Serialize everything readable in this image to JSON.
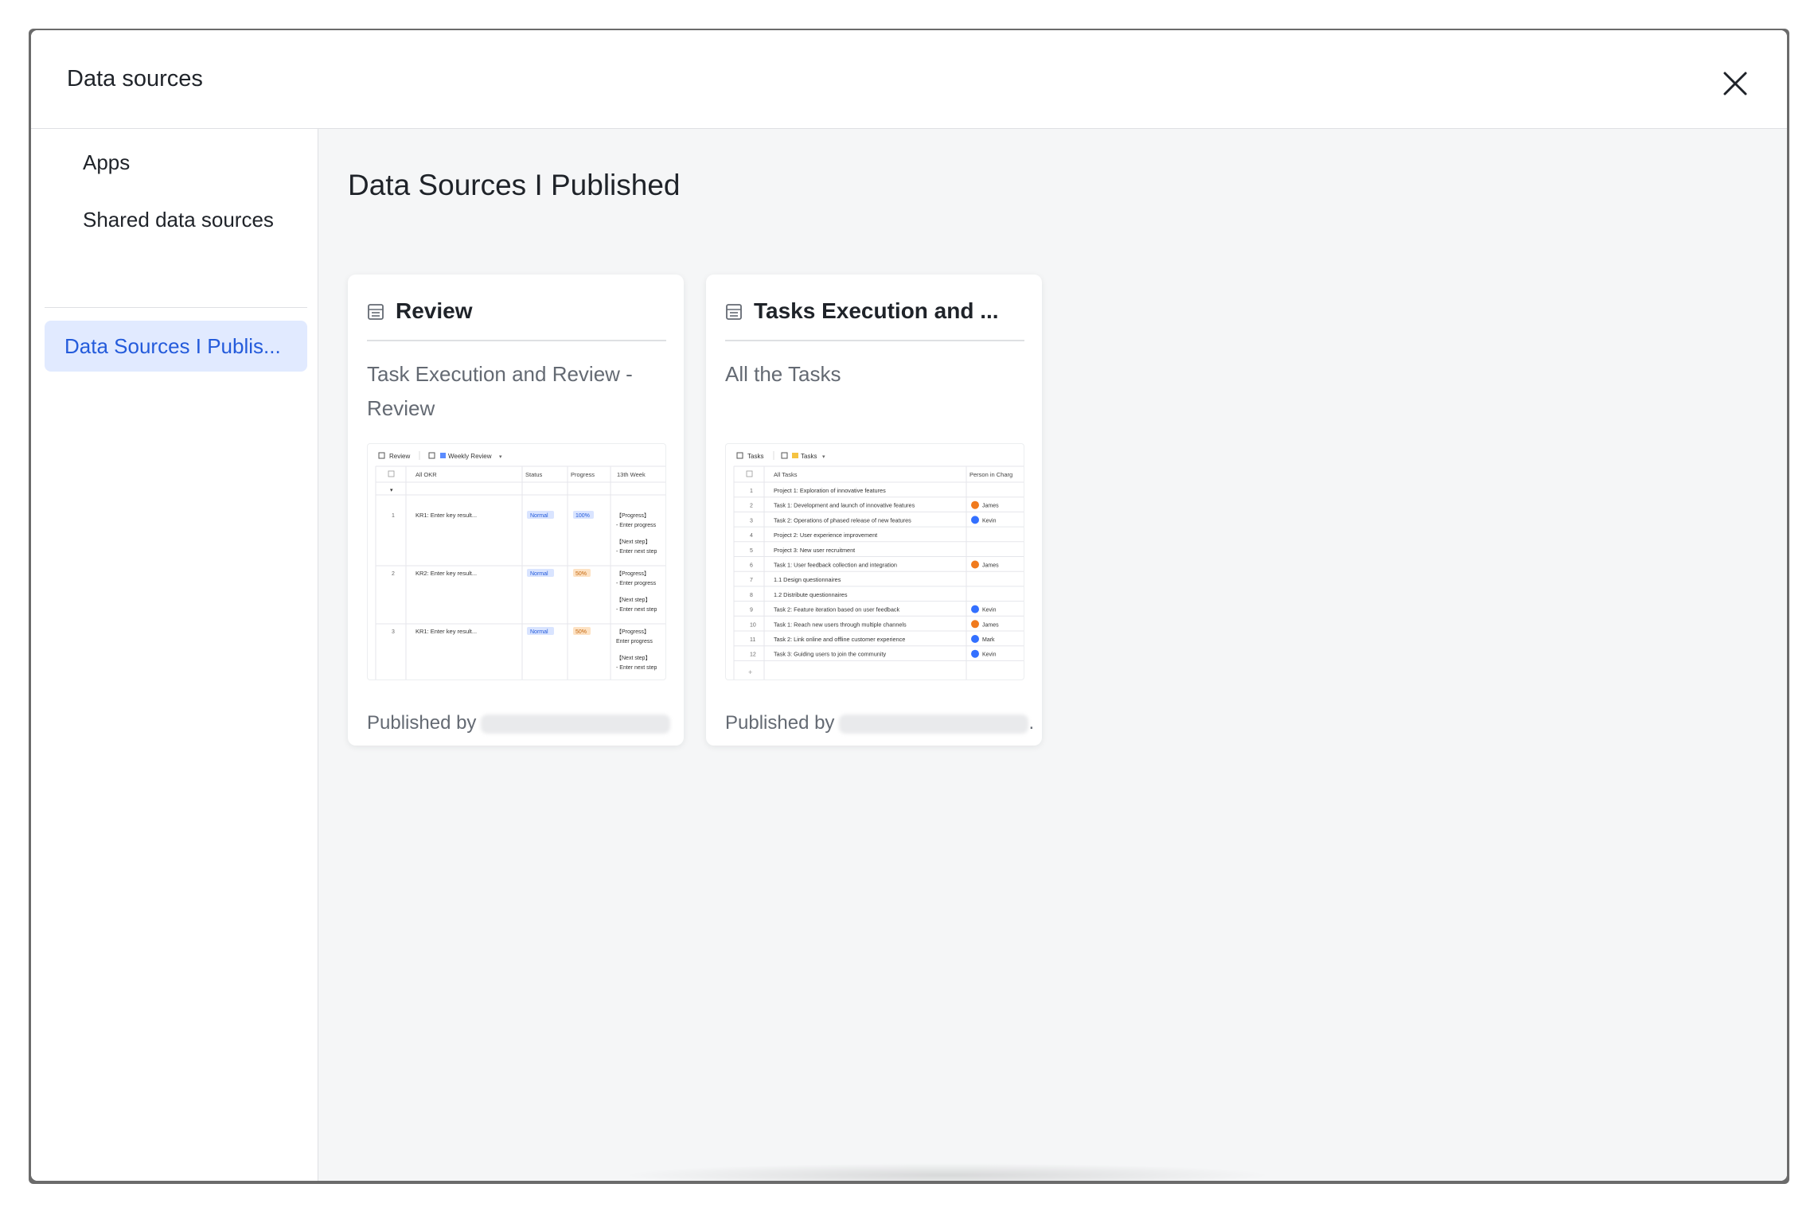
{
  "modal": {
    "title": "Data sources"
  },
  "sidebar": {
    "items": [
      {
        "label": "Apps"
      },
      {
        "label": "Shared data sources"
      },
      {
        "label": "Data Sources I Publis..."
      }
    ]
  },
  "main": {
    "title": "Data Sources I Published",
    "cards": [
      {
        "title": "Review",
        "description": "Task Execution and Review - Review",
        "published_by": "Published by",
        "thumbnail": {
          "table_name": "Review",
          "view_name": "Weekly Review",
          "headers": [
            "All OKR",
            "Status",
            "Progress",
            "13th Week"
          ],
          "rows": [
            {
              "num": "1",
              "okr": "KR1: Enter key result...",
              "status": "Normal",
              "progress": "100%",
              "notes": [
                "【Progress】",
                "- Enter progress",
                "【Next step】",
                "- Enter next step"
              ]
            },
            {
              "num": "2",
              "okr": "KR2: Enter key result...",
              "status": "Normal",
              "progress": "50%",
              "notes": [
                "【Progress】",
                "- Enter progress",
                "【Next step】",
                "- Enter next step"
              ]
            },
            {
              "num": "3",
              "okr": "KR1: Enter key result...",
              "status": "Normal",
              "progress": "50%",
              "notes": [
                "【Progress】",
                "Enter progress",
                "【Next step】",
                "- Enter next step"
              ]
            }
          ]
        }
      },
      {
        "title": "Tasks Execution and ...",
        "description": "All the Tasks",
        "published_by": "Published by",
        "footer_suffix": ".",
        "thumbnail": {
          "table_name": "Tasks",
          "view_name": "Tasks",
          "headers": [
            "All Tasks",
            "Person in Charg"
          ],
          "rows": [
            {
              "num": "1",
              "task": "Project 1: Exploration of innovative features",
              "person": ""
            },
            {
              "num": "2",
              "task": "Task 1: Development and launch of innovative features",
              "person": "James"
            },
            {
              "num": "3",
              "task": "Task 2: Operations of phased release of new features",
              "person": "Kevin"
            },
            {
              "num": "4",
              "task": "Project 2: User experience improvement",
              "person": ""
            },
            {
              "num": "5",
              "task": "Project 3: New user recruitment",
              "person": ""
            },
            {
              "num": "6",
              "task": "Task 1: User feedback collection and integration",
              "person": "James"
            },
            {
              "num": "7",
              "task": "1.1 Design questionnaires",
              "person": ""
            },
            {
              "num": "8",
              "task": "1.2 Distribute questionnaires",
              "person": ""
            },
            {
              "num": "9",
              "task": "Task 2: Feature iteration based on user feedback",
              "person": "Kevin"
            },
            {
              "num": "10",
              "task": "Task 1: Reach new users through multiple channels",
              "person": "James"
            },
            {
              "num": "11",
              "task": "Task 2: Link online and offline customer experience",
              "person": "Mark"
            },
            {
              "num": "12",
              "task": "Task 3: Guiding users to join the community",
              "person": "Kevin"
            }
          ]
        }
      }
    ]
  },
  "colors": {
    "accent": "#245bdb",
    "active_bg": "#e1eaff",
    "james": "#f07a1d",
    "kevin": "#3370ff",
    "mark": "#3370ff",
    "normal_tag": "#d9e4ff",
    "progress_100": "#d9e4ff",
    "progress_50": "#fde2c4"
  },
  "icons": [
    "close-icon",
    "table-icon",
    "grid-icon"
  ]
}
